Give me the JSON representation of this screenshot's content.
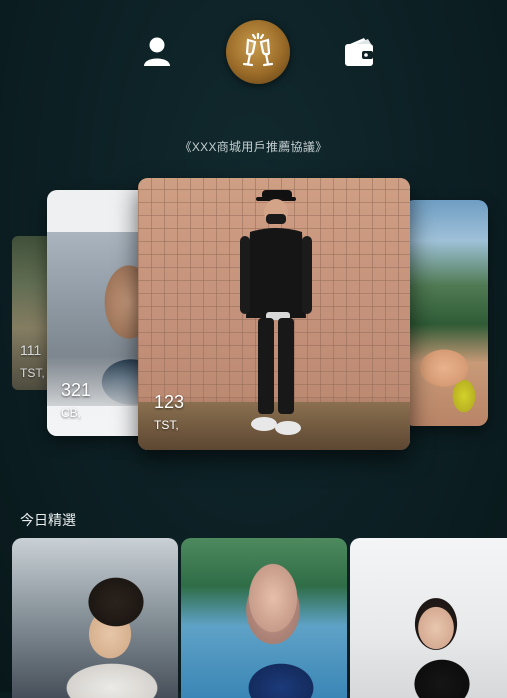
{
  "nav": {
    "profile_icon": "person-icon",
    "cheers_icon": "champagne-glasses-icon",
    "wallet_icon": "wallet-icon",
    "active": "cheers",
    "accent": "#b07f35"
  },
  "agreement_text": "《XXX商城用戶推薦協議》",
  "carousel": [
    {
      "num": "111",
      "tag": "TST,"
    },
    {
      "num": "321",
      "tag": "CB,"
    },
    {
      "num": "123",
      "tag": "TST,"
    },
    {
      "num": "",
      "tag": ""
    }
  ],
  "section": {
    "title": "今日精選"
  },
  "colors": {
    "background": "#0e2226",
    "text_muted": "#c4cfd0"
  }
}
